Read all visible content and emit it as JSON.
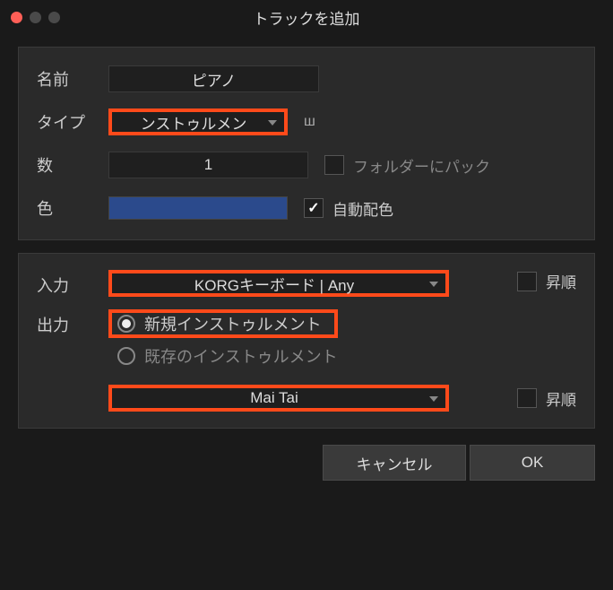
{
  "window": {
    "title": "トラックを追加"
  },
  "section1": {
    "name_label": "名前",
    "name_value": "ピアノ",
    "type_label": "タイプ",
    "type_value": "ンストゥルメン",
    "count_label": "数",
    "count_value": "1",
    "pack_label": "フォルダーにパック",
    "color_label": "色",
    "color_value": "#2b4a8c",
    "auto_color_label": "自動配色"
  },
  "section2": {
    "input_label": "入力",
    "input_value": "KORGキーボード | Any",
    "asc_label": "昇順",
    "output_label": "出力",
    "radio_new": "新規インストゥルメント",
    "radio_existing": "既存のインストゥルメント",
    "instrument_value": "Mai Tai",
    "asc2_label": "昇順"
  },
  "buttons": {
    "cancel": "キャンセル",
    "ok": "OK"
  }
}
